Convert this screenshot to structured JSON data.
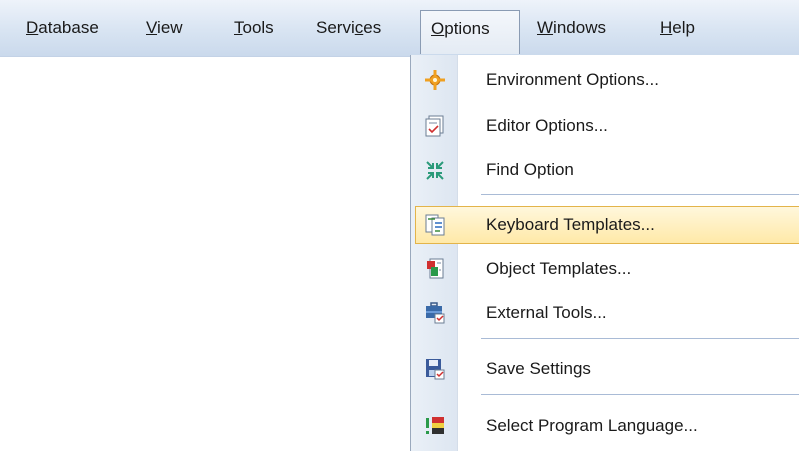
{
  "menubar": {
    "items": [
      {
        "id": "database",
        "pre": "",
        "u": "D",
        "post": "atabase"
      },
      {
        "id": "view",
        "pre": "",
        "u": "V",
        "post": "iew"
      },
      {
        "id": "tools",
        "pre": "",
        "u": "T",
        "post": "ools"
      },
      {
        "id": "services",
        "pre": "Servi",
        "u": "c",
        "post": "es"
      },
      {
        "id": "options",
        "pre": "",
        "u": "O",
        "post": "ptions"
      },
      {
        "id": "windows",
        "pre": "",
        "u": "W",
        "post": "indows"
      },
      {
        "id": "help",
        "pre": "",
        "u": "H",
        "post": "elp"
      }
    ],
    "active": "options"
  },
  "options_menu": {
    "items": [
      {
        "label": "Environment Options...",
        "icon": "environment-options-icon"
      },
      {
        "label": "Editor Options...",
        "icon": "editor-options-icon"
      },
      {
        "label": "Find Option",
        "icon": "find-option-icon"
      },
      {
        "label": "Keyboard Templates...",
        "icon": "keyboard-templates-icon",
        "highlighted": true
      },
      {
        "label": "Object Templates...",
        "icon": "object-templates-icon"
      },
      {
        "label": "External Tools...",
        "icon": "external-tools-icon"
      },
      {
        "label": "Save Settings",
        "icon": "save-settings-icon"
      },
      {
        "label": "Select Program Language...",
        "icon": "select-language-icon"
      }
    ]
  },
  "colors": {
    "highlight_fill": "#ffe9a8",
    "highlight_border": "#e3b44a",
    "menubar_bg": "#d8e4f2"
  }
}
